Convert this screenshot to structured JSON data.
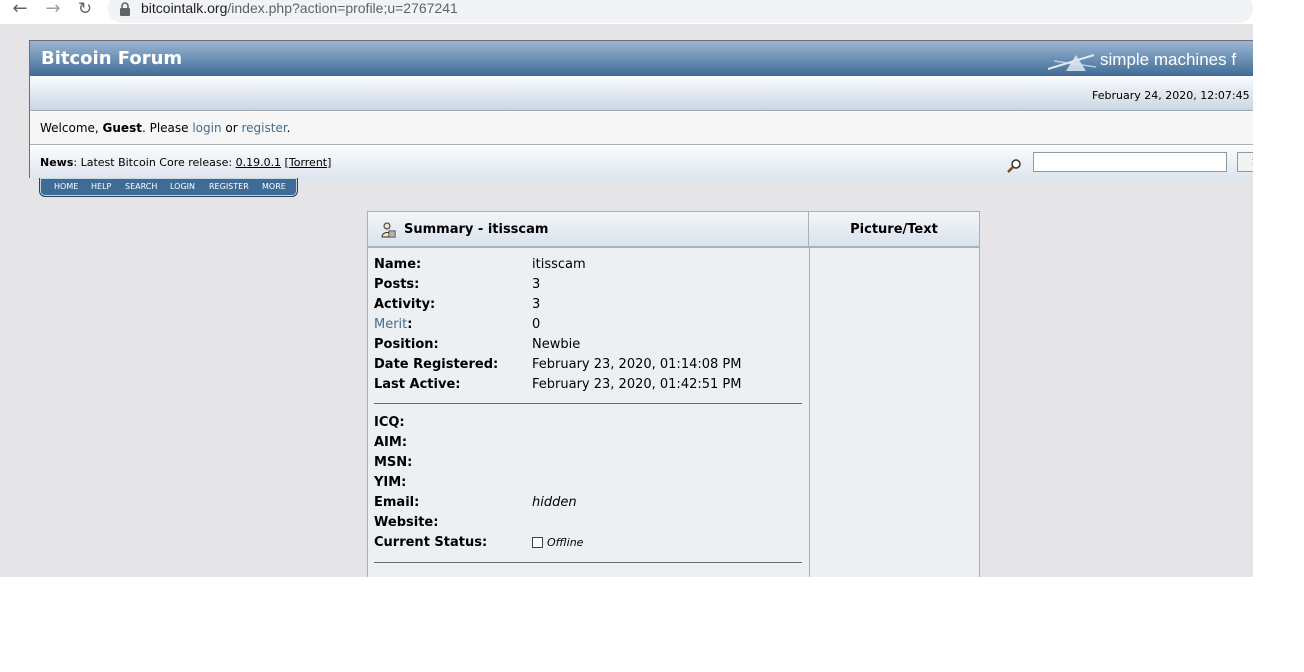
{
  "browser": {
    "url_host": "bitcointalk.org",
    "url_path": "/index.php?action=profile;u=2767241"
  },
  "header": {
    "forum_title": "Bitcoin Forum",
    "smf_text": "simple machines f",
    "date_time": "February 24, 2020, 12:07:45"
  },
  "welcome": {
    "prefix": "Welcome, ",
    "user": "Guest",
    "please": ". Please ",
    "login": "login",
    "or": " or ",
    "register": "register",
    "end": "."
  },
  "news": {
    "label": "News",
    "text": ": Latest Bitcoin Core release: ",
    "version": "0.19.0.1",
    "torrent_open": " [",
    "torrent": "Torrent",
    "torrent_close": "]",
    "search_value": "",
    "search_button": "S"
  },
  "menu": {
    "items": [
      "HOME",
      "HELP",
      "SEARCH",
      "LOGIN",
      "REGISTER",
      "MORE"
    ]
  },
  "profile": {
    "summary_title": "Summary - itisscam",
    "picture_title": "Picture/Text",
    "rows": [
      {
        "label": "Name:",
        "value": "itisscam"
      },
      {
        "label": "Posts:",
        "value": "3"
      },
      {
        "label": "Activity:",
        "value": "3"
      },
      {
        "label": "Merit",
        "suffix": ":",
        "value": "0"
      },
      {
        "label": "Position:",
        "value": "Newbie"
      },
      {
        "label": "Date Registered:",
        "value": "February 23, 2020, 01:14:08 PM"
      },
      {
        "label": "Last Active:",
        "value": "February 23, 2020, 01:42:51 PM"
      }
    ],
    "contact_rows": [
      {
        "label": "ICQ:",
        "value": ""
      },
      {
        "label": "AIM:",
        "value": ""
      },
      {
        "label": "MSN:",
        "value": ""
      },
      {
        "label": "YIM:",
        "value": ""
      },
      {
        "label": "Email:",
        "value": "hidden"
      },
      {
        "label": "Website:",
        "value": ""
      },
      {
        "label": "Current Status:",
        "value": "Offline"
      }
    ]
  }
}
